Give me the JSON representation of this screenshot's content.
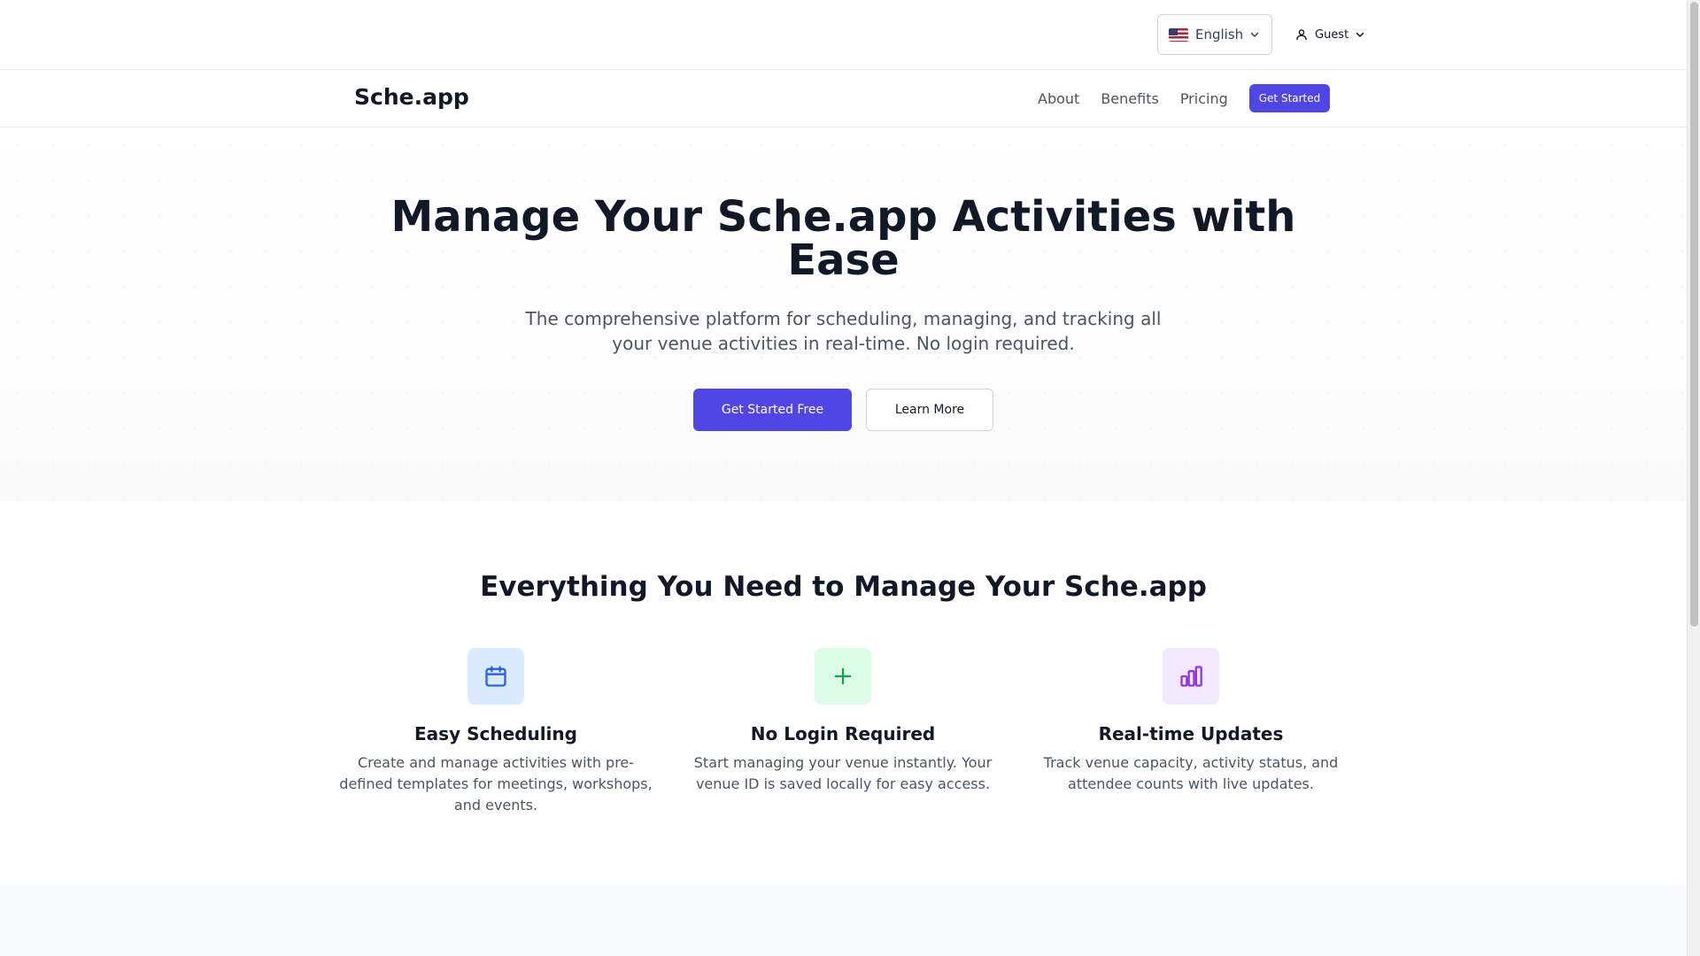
{
  "topbar": {
    "language": "English",
    "user": "Guest"
  },
  "navbar": {
    "brand": "Sche.app",
    "links": [
      "About",
      "Benefits",
      "Pricing"
    ],
    "cta": "Get Started"
  },
  "hero": {
    "title": "Manage Your Sche.app Activities with Ease",
    "subtitle": "The comprehensive platform for scheduling, managing, and tracking all your venue activities in real-time. No login required.",
    "primary_button": "Get Started Free",
    "secondary_button": "Learn More"
  },
  "features": {
    "title": "Everything You Need to Manage Your Sche.app",
    "items": [
      {
        "icon": "calendar-icon",
        "color": "#2563eb",
        "bg": "#dbeafe",
        "title": "Easy Scheduling",
        "description": "Create and manage activities with pre-defined templates for meetings, workshops, and events."
      },
      {
        "icon": "plus-icon",
        "color": "#16a34a",
        "bg": "#dcfce7",
        "title": "No Login Required",
        "description": "Start managing your venue instantly. Your venue ID is saved locally for easy access."
      },
      {
        "icon": "bar-chart-icon",
        "color": "#9333ea",
        "bg": "#f3e8ff",
        "title": "Real-time Updates",
        "description": "Track venue capacity, activity status, and attendee counts with live updates."
      }
    ]
  },
  "colors": {
    "accent": "#4f46e5",
    "text": "#111827",
    "muted": "#4b5563"
  }
}
